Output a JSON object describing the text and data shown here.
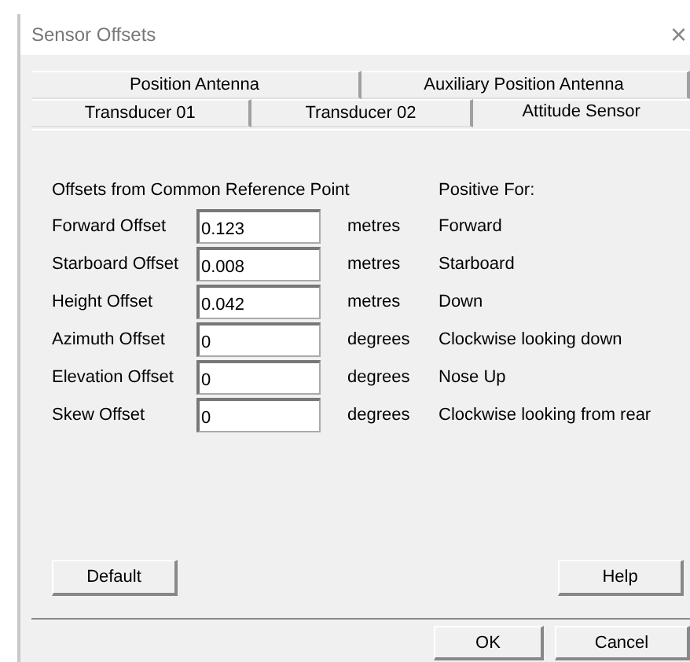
{
  "window": {
    "title": "Sensor Offsets",
    "close": "×"
  },
  "tab_rows": [
    {
      "tabs": [
        {
          "label": "Position Antenna",
          "selected": false
        },
        {
          "label": "Auxiliary Position Antenna",
          "selected": false
        }
      ]
    },
    {
      "tabs": [
        {
          "label": "Transducer 01",
          "selected": false
        },
        {
          "label": "Transducer 02",
          "selected": false
        },
        {
          "label": "Attitude Sensor",
          "selected": true
        }
      ]
    }
  ],
  "heading": "Offsets from Common Reference Point",
  "positive_heading": "Positive For:",
  "rows": [
    {
      "label": "Forward Offset",
      "value": "0.123",
      "unit": "metres",
      "positive": "Forward"
    },
    {
      "label": "Starboard Offset",
      "value": "0.008",
      "unit": "metres",
      "positive": "Starboard"
    },
    {
      "label": "Height Offset",
      "value": "0.042",
      "unit": "metres",
      "positive": "Down"
    },
    {
      "label": "Azimuth Offset",
      "value": "0",
      "unit": "degrees",
      "positive": "Clockwise looking down"
    },
    {
      "label": "Elevation Offset",
      "value": "0",
      "unit": "degrees",
      "positive": "Nose Up"
    },
    {
      "label": "Skew Offset",
      "value": "0",
      "unit": "degrees",
      "positive": "Clockwise looking from rear"
    }
  ],
  "panel_buttons": [
    "Default",
    "Help"
  ],
  "buttons": [
    "OK",
    "Cancel"
  ]
}
